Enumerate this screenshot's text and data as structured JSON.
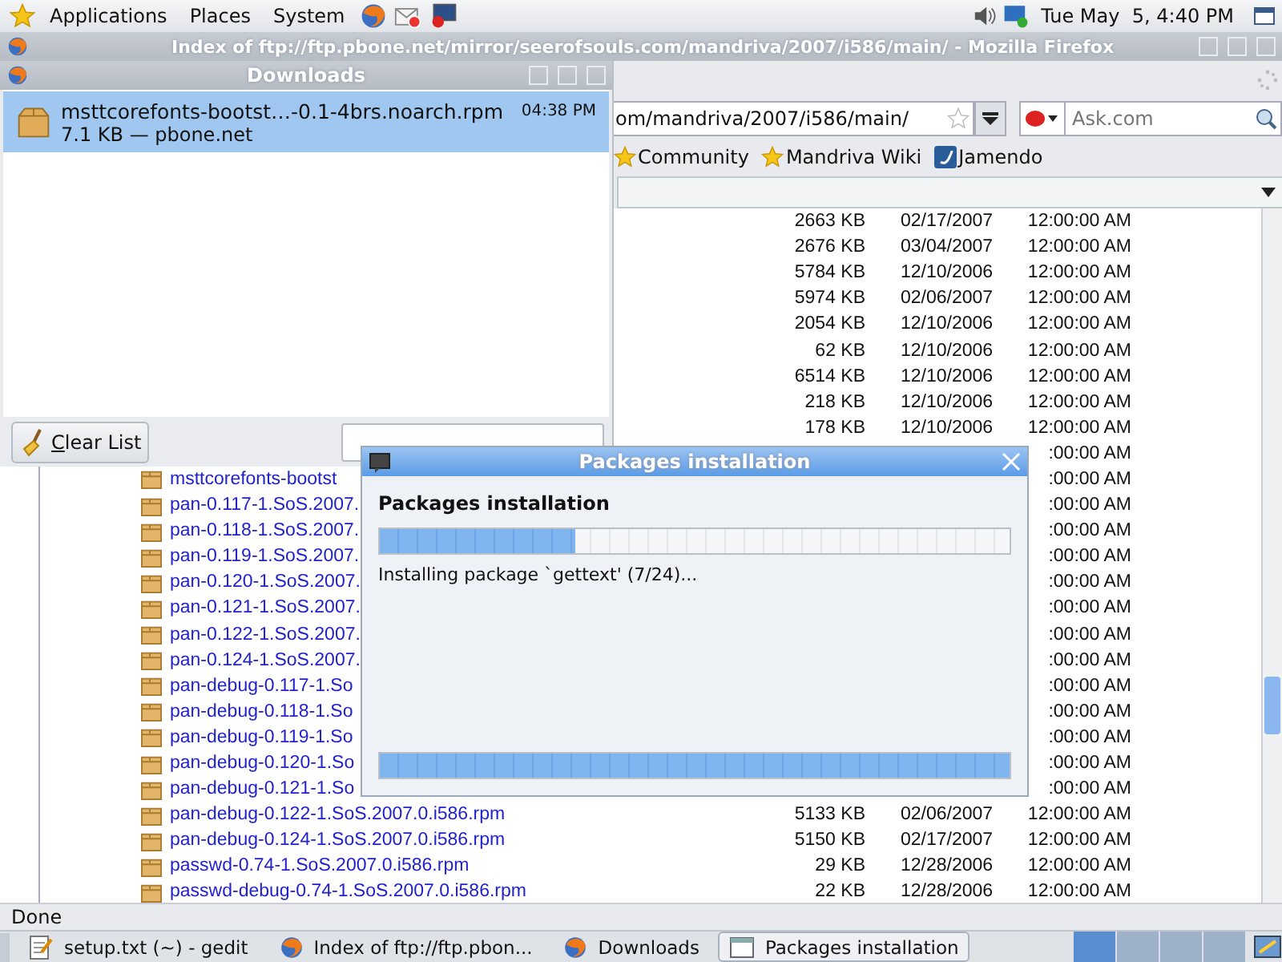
{
  "top_panel": {
    "menus": [
      "Applications",
      "Places",
      "System"
    ],
    "clock": "Tue May  5, 4:40 PM"
  },
  "browser": {
    "title": "Index of ftp://ftp.pbone.net/mirror/seerofsouls.com/mandriva/2007/i586/main/ - Mozilla Firefox",
    "url": "om/mandriva/2007/i586/main/",
    "search": {
      "placeholder": "Ask.com"
    },
    "bookmarks": [
      {
        "label": "Community",
        "kind": "star"
      },
      {
        "label": "Mandriva Wiki",
        "kind": "star"
      },
      {
        "label": "Jamendo",
        "kind": "site"
      }
    ],
    "rows": [
      {
        "size": "2663 KB",
        "date": "02/17/2007",
        "time": "12:00:00 AM"
      },
      {
        "size": "2676 KB",
        "date": "03/04/2007",
        "time": "12:00:00 AM"
      },
      {
        "size": "5784 KB",
        "date": "12/10/2006",
        "time": "12:00:00 AM"
      },
      {
        "size": "5974 KB",
        "date": "02/06/2007",
        "time": "12:00:00 AM"
      },
      {
        "size": "2054 KB",
        "date": "12/10/2006",
        "time": "12:00:00 AM"
      },
      {
        "size": "62 KB",
        "date": "12/10/2006",
        "time": "12:00:00 AM"
      },
      {
        "size": "6514 KB",
        "date": "12/10/2006",
        "time": "12:00:00 AM"
      },
      {
        "size": "218 KB",
        "date": "12/10/2006",
        "time": "12:00:00 AM"
      },
      {
        "size": "178 KB",
        "date": "12/10/2006",
        "time": "12:00:00 AM"
      },
      {
        "time": ":00:00 AM"
      },
      {
        "name": "msttcorefonts-bootst",
        "time": ":00:00 AM"
      },
      {
        "name": "pan-0.117-1.SoS.2007.",
        "time": ":00:00 AM"
      },
      {
        "name": "pan-0.118-1.SoS.2007.",
        "time": ":00:00 AM"
      },
      {
        "name": "pan-0.119-1.SoS.2007.",
        "time": ":00:00 AM"
      },
      {
        "name": "pan-0.120-1.SoS.2007.",
        "time": ":00:00 AM"
      },
      {
        "name": "pan-0.121-1.SoS.2007.",
        "time": ":00:00 AM"
      },
      {
        "name": "pan-0.122-1.SoS.2007.",
        "time": ":00:00 AM"
      },
      {
        "name": "pan-0.124-1.SoS.2007.",
        "time": ":00:00 AM"
      },
      {
        "name": "pan-debug-0.117-1.So",
        "time": ":00:00 AM"
      },
      {
        "name": "pan-debug-0.118-1.So",
        "time": ":00:00 AM"
      },
      {
        "name": "pan-debug-0.119-1.So",
        "time": ":00:00 AM"
      },
      {
        "name": "pan-debug-0.120-1.So",
        "time": ":00:00 AM"
      },
      {
        "name": "pan-debug-0.121-1.So",
        "time": ":00:00 AM"
      },
      {
        "name": "pan-debug-0.122-1.SoS.2007.0.i586.rpm",
        "size": "5133 KB",
        "date": "02/06/2007",
        "time": "12:00:00 AM"
      },
      {
        "name": "pan-debug-0.124-1.SoS.2007.0.i586.rpm",
        "size": "5150 KB",
        "date": "02/17/2007",
        "time": "12:00:00 AM"
      },
      {
        "name": "passwd-0.74-1.SoS.2007.0.i586.rpm",
        "size": "29 KB",
        "date": "12/28/2006",
        "time": "12:00:00 AM"
      },
      {
        "name": "passwd-debug-0.74-1.SoS.2007.0.i586.rpm",
        "size": "22 KB",
        "date": "12/28/2006",
        "time": "12:00:00 AM"
      }
    ],
    "status": "Done"
  },
  "downloads": {
    "title": "Downloads",
    "items": [
      {
        "name": "msttcorefonts-bootst…-0.1-4brs.noarch.rpm",
        "time": "04:38 PM",
        "info": "7.1 KB — pbone.net",
        "selected": true
      }
    ],
    "clear_button": "Clear List"
  },
  "installer": {
    "title": "Packages installation",
    "heading": "Packages installation",
    "progress": {
      "level": 0.31
    },
    "message": "Installing package `gettext' (7/24)...",
    "activity": {
      "level": 1
    }
  },
  "taskbar": [
    {
      "label": "setup.txt (~) - gedit",
      "kind": "editor",
      "selected": false
    },
    {
      "label": "Index of ftp://ftp.pbon...",
      "kind": "browser",
      "selected": false
    },
    {
      "label": "Downloads",
      "kind": "browser",
      "selected": false
    },
    {
      "label": "Packages installation",
      "kind": "window",
      "selected": true
    }
  ]
}
